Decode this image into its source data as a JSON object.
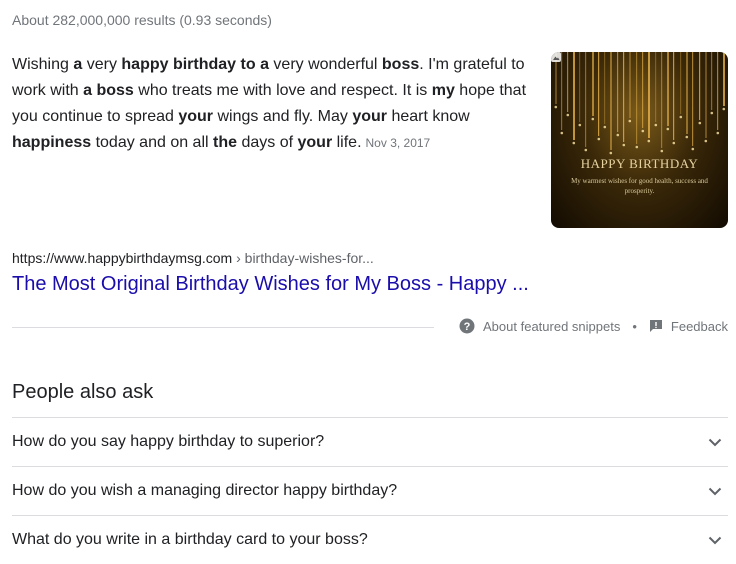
{
  "results_stats": "About 282,000,000 results (0.93 seconds)",
  "snippet": {
    "segments": [
      {
        "text": "Wishing ",
        "bold": false
      },
      {
        "text": "a",
        "bold": true
      },
      {
        "text": " very ",
        "bold": false
      },
      {
        "text": "happy birthday to a",
        "bold": true
      },
      {
        "text": " very wonderful ",
        "bold": false
      },
      {
        "text": "boss",
        "bold": true
      },
      {
        "text": ". I'm grateful to work with ",
        "bold": false
      },
      {
        "text": "a boss",
        "bold": true
      },
      {
        "text": " who treats me with love and respect. It is ",
        "bold": false
      },
      {
        "text": "my",
        "bold": true
      },
      {
        "text": " hope that you continue to spread ",
        "bold": false
      },
      {
        "text": "your",
        "bold": true
      },
      {
        "text": " wings and fly. May ",
        "bold": false
      },
      {
        "text": "your",
        "bold": true
      },
      {
        "text": " heart know ",
        "bold": false
      },
      {
        "text": "happiness",
        "bold": true
      },
      {
        "text": " today and on all ",
        "bold": false
      },
      {
        "text": "the",
        "bold": true
      },
      {
        "text": " days of ",
        "bold": false
      },
      {
        "text": "your",
        "bold": true
      },
      {
        "text": " life.",
        "bold": false
      }
    ],
    "date": "Nov 3, 2017"
  },
  "thumbnail": {
    "title": "HAPPY BIRTHDAY",
    "subtitle": "My warmest wishes for good health, success and prosperity.",
    "gold": "#e6b24a"
  },
  "result": {
    "url_host": "https://www.happybirthdaymsg.com",
    "url_path": " › birthday-wishes-for...",
    "title": "The Most Original Birthday Wishes for My Boss - Happy ...",
    "link_color": "#1a0dab"
  },
  "snippet_footer": {
    "about_label": "About featured snippets",
    "separator": "•",
    "feedback_label": "Feedback"
  },
  "people_also_ask": {
    "heading": "People also ask",
    "questions": [
      "How do you say happy birthday to superior?",
      "How do you wish a managing director happy birthday?",
      "What do you write in a birthday card to your boss?"
    ]
  }
}
